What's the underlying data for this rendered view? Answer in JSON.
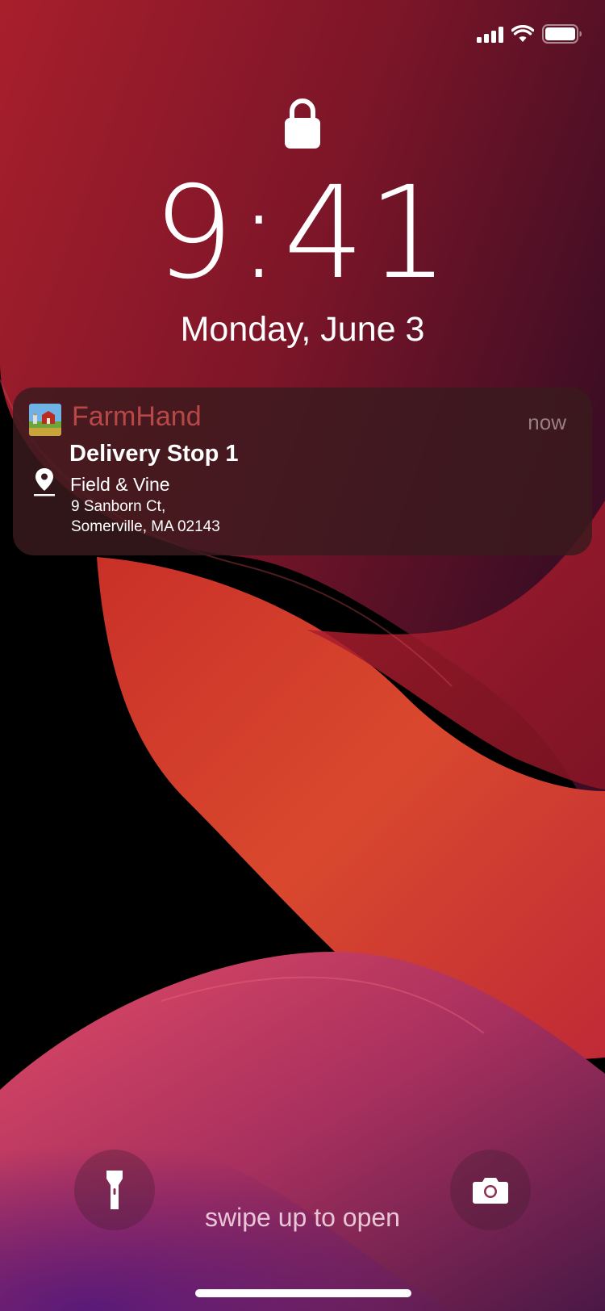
{
  "status_bar": {
    "signal_icon": "cellular-signal-icon",
    "wifi_icon": "wifi-icon",
    "battery_icon": "battery-icon",
    "battery_level": 1.0
  },
  "lock": {
    "icon": "lock-icon"
  },
  "clock": {
    "time": "9:41",
    "date": "Monday, June 3"
  },
  "notification": {
    "app_name": "FarmHand",
    "app_icon": "farm-barn-icon",
    "time": "now",
    "title": "Delivery Stop 1",
    "location_icon": "map-pin-icon",
    "place": "Field & Vine",
    "address_line1": "9 Sanborn Ct,",
    "address_line2": "Somerville, MA 02143",
    "colors": {
      "app_name": "#b84848",
      "card": "#3a1a1e"
    }
  },
  "bottom": {
    "flashlight_icon": "flashlight-icon",
    "camera_icon": "camera-icon",
    "hint": "swipe up to open"
  }
}
